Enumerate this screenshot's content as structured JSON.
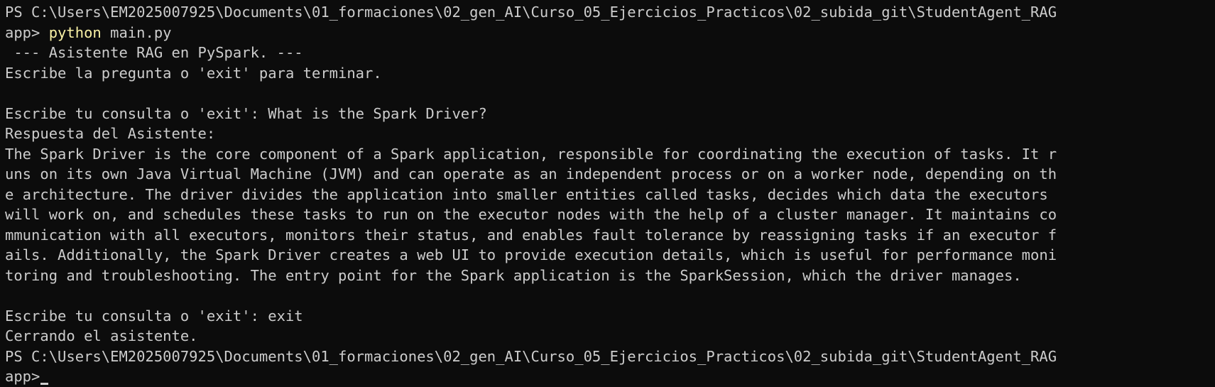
{
  "terminal": {
    "lines": [
      "PS C:\\Users\\EM2025007925\\Documents\\01_formaciones\\02_gen_AI\\Curso_05_Ejercicios_Practicos\\02_subida_git\\StudentAgent_RAG",
      "app> ",
      " --- Asistente RAG en PySpark. ---",
      "Escribe la pregunta o 'exit' para terminar.",
      "",
      "Escribe tu consulta o 'exit': What is the Spark Driver?",
      "Respuesta del Asistente:",
      "The Spark Driver is the core component of a Spark application, responsible for coordinating the execution of tasks. It r",
      "uns on its own Java Virtual Machine (JVM) and can operate as an independent process or on a worker node, depending on th",
      "e architecture. The driver divides the application into smaller entities called tasks, decides which data the executors",
      "will work on, and schedules these tasks to run on the executor nodes with the help of a cluster manager. It maintains co",
      "mmunication with all executors, monitors their status, and enables fault tolerance by reassigning tasks if an executor f",
      "ails. Additionally, the Spark Driver creates a web UI to provide execution details, which is useful for performance moni",
      "toring and troubleshooting. The entry point for the Spark application is the SparkSession, which the driver manages.",
      "",
      "Escribe tu consulta o 'exit': exit",
      "Cerrando el asistente.",
      "PS C:\\Users\\EM2025007925\\Documents\\01_formaciones\\02_gen_AI\\Curso_05_Ejercicios_Practicos\\02_subida_git\\StudentAgent_RAG",
      "app>"
    ],
    "command": {
      "program": "python",
      "args": " main.py"
    },
    "colors": {
      "background": "#0c0c0c",
      "foreground": "#cccccc",
      "command": "#f9f1a5"
    }
  }
}
